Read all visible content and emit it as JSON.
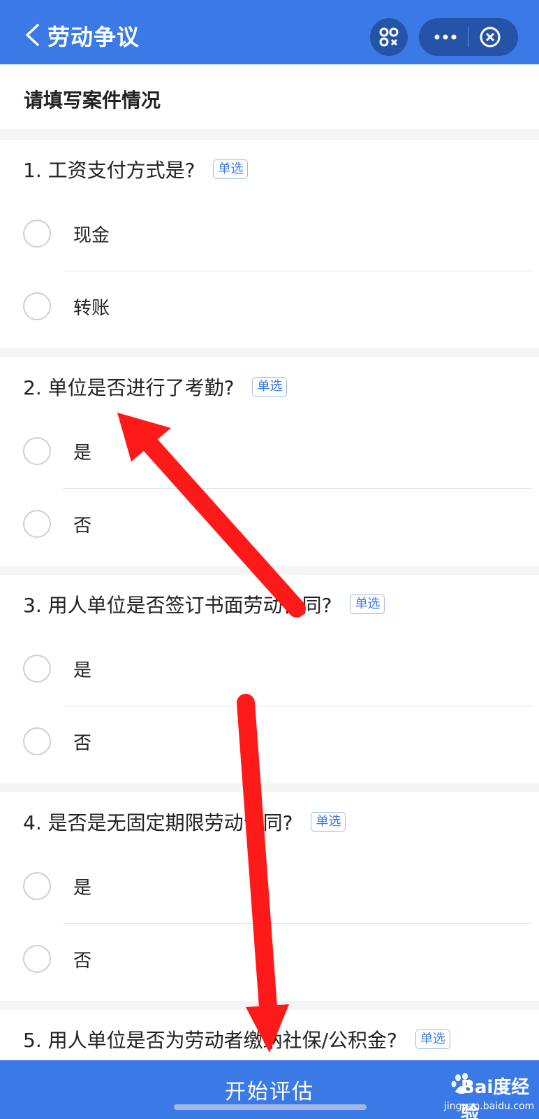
{
  "header": {
    "title": "劳动争议"
  },
  "subtitle": "请填写案件情况",
  "questions": [
    {
      "text": "1. 工资支付方式是?",
      "badge": "单选",
      "options": [
        "现金",
        "转账"
      ]
    },
    {
      "text": "2. 单位是否进行了考勤?",
      "badge": "单选",
      "options": [
        "是",
        "否"
      ]
    },
    {
      "text": "3. 用人单位是否签订书面劳动合同?",
      "badge": "单选",
      "options": [
        "是",
        "否"
      ]
    },
    {
      "text": "4. 是否是无固定期限劳动合同?",
      "badge": "单选",
      "options": [
        "是",
        "否"
      ]
    },
    {
      "text": "5. 用人单位是否为劳动者缴纳社保/公积金?",
      "badge": "单选",
      "options": []
    }
  ],
  "footer": {
    "start_label": "开始评估"
  },
  "watermark": {
    "brand": "Bai度经验",
    "site": "jingyan.baidu.com"
  },
  "colors": {
    "header_bg": "#3b7ae6",
    "annotation_arrow": "#ff1a1a"
  }
}
